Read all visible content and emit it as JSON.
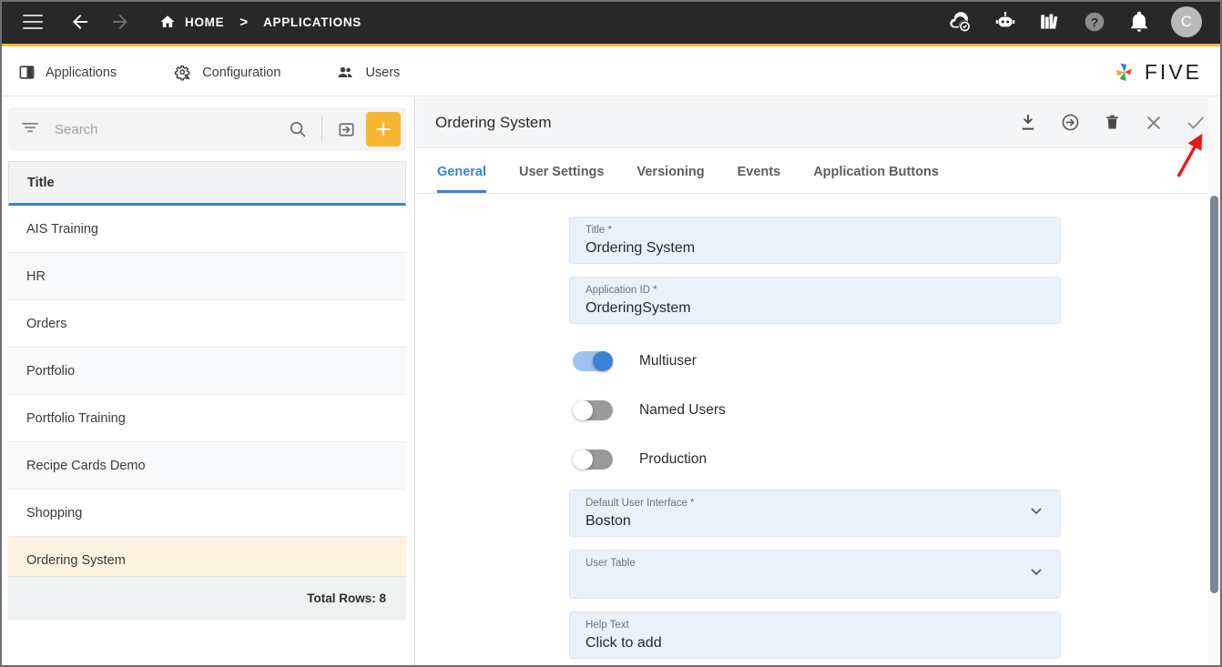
{
  "topbar": {
    "menu_icon": "hamburger-icon",
    "back_icon": "arrow-back-icon",
    "forward_icon": "arrow-forward-icon",
    "home_icon": "home-icon",
    "breadcrumb": {
      "home": "HOME",
      "separator": ">",
      "current": "APPLICATIONS"
    },
    "icons": [
      {
        "name": "cloud-check-icon"
      },
      {
        "name": "chat-bot-icon"
      },
      {
        "name": "library-books-icon"
      },
      {
        "name": "help-icon"
      },
      {
        "name": "notifications-bell-icon"
      }
    ],
    "avatar_initial": "C",
    "accent_color": "#f5b731",
    "background_color": "#282828"
  },
  "navtabs": [
    {
      "label": "Applications",
      "icon": "applications-icon"
    },
    {
      "label": "Configuration",
      "icon": "configuration-gear-icon"
    },
    {
      "label": "Users",
      "icon": "users-icon"
    }
  ],
  "brand": {
    "text": "FIVE",
    "logo_icon": "five-pinwheel-logo"
  },
  "search": {
    "placeholder": "Search",
    "value": "",
    "filter_icon": "filter-icon",
    "search_icon": "search-icon",
    "import_icon": "import-icon",
    "add_label": "+",
    "add_color": "#f7b733"
  },
  "grid": {
    "column_header": "Title",
    "rows": [
      {
        "title": "AIS Training",
        "selected": false
      },
      {
        "title": "HR",
        "selected": false
      },
      {
        "title": "Orders",
        "selected": false
      },
      {
        "title": "Portfolio",
        "selected": false
      },
      {
        "title": "Portfolio Training",
        "selected": false
      },
      {
        "title": "Recipe Cards Demo",
        "selected": false
      },
      {
        "title": "Shopping",
        "selected": false
      },
      {
        "title": "Ordering System",
        "selected": true
      }
    ],
    "footer": "Total Rows: 8",
    "selected_color": "#fdf3e0",
    "header_underline_color": "#3b82d6"
  },
  "detail": {
    "title": "Ordering System",
    "actions": [
      {
        "name": "download-icon"
      },
      {
        "name": "export-icon"
      },
      {
        "name": "delete-icon"
      },
      {
        "name": "close-icon"
      },
      {
        "name": "save-check-icon"
      }
    ],
    "tabs": [
      {
        "label": "General",
        "active": true
      },
      {
        "label": "User Settings",
        "active": false
      },
      {
        "label": "Versioning",
        "active": false
      },
      {
        "label": "Events",
        "active": false
      },
      {
        "label": "Application Buttons",
        "active": false
      }
    ],
    "active_tab_color": "#3b82d6",
    "fields": {
      "title": {
        "label": "Title",
        "required": true,
        "value": "Ordering System"
      },
      "application_id": {
        "label": "Application ID",
        "required": true,
        "value": "OrderingSystem"
      },
      "multiuser": {
        "label": "Multiuser",
        "on": true
      },
      "named_users": {
        "label": "Named Users",
        "on": false
      },
      "production": {
        "label": "Production",
        "on": false
      },
      "default_user_interface": {
        "label": "Default User Interface",
        "required": true,
        "value": "Boston",
        "chevron": "chevron-down-icon"
      },
      "user_table": {
        "label": "User Table",
        "required": false,
        "value": "",
        "chevron": "chevron-down-icon"
      },
      "help_text": {
        "label": "Help Text",
        "required": false,
        "value": "Click to add"
      }
    },
    "field_background": "#e9f1fa"
  },
  "annotation": {
    "type": "red-arrow",
    "points_to": "save-check-icon",
    "color": "#e8191a"
  }
}
